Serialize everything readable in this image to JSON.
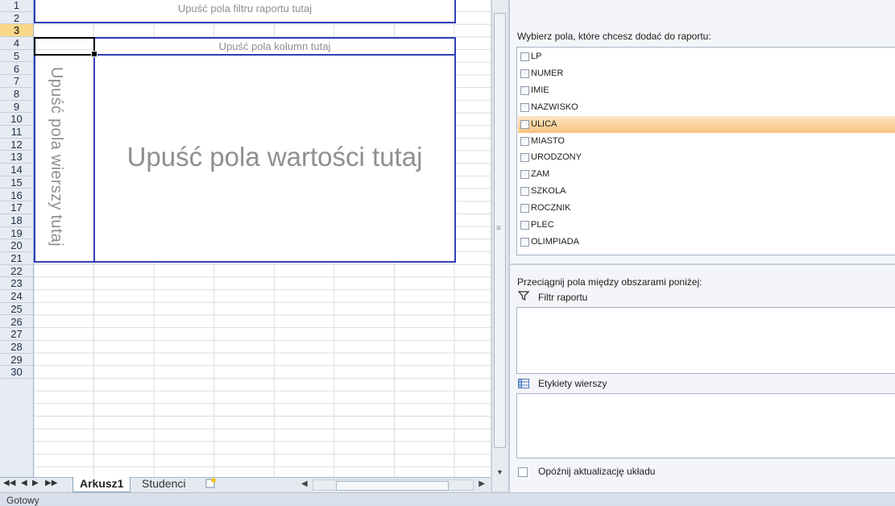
{
  "sheet": {
    "row_numbers": [
      "1",
      "2",
      "3",
      "4",
      "5",
      "6",
      "7",
      "8",
      "9",
      "10",
      "11",
      "12",
      "13",
      "14",
      "15",
      "16",
      "17",
      "18",
      "19",
      "20",
      "21",
      "22",
      "23",
      "24",
      "25",
      "26",
      "27",
      "28",
      "29",
      "30"
    ],
    "selected_row": "3",
    "filter_drop_text": "Upuść pola filtru raportu tutaj",
    "column_drop_text": "Upuść pola kolumn tutaj",
    "row_drop_text": "Upuść pola wierszy tutaj",
    "values_drop_text": "Upuść pola wartości tutaj"
  },
  "tabs": {
    "nav_first": "◀◀",
    "nav_prev": "◀",
    "nav_next": "▶",
    "nav_last": "▶▶",
    "items": [
      "Arkusz1",
      "Studenci"
    ],
    "active": "Arkusz1",
    "new_tab_icon": "insert-worksheet-icon"
  },
  "statusbar": {
    "text": "Gotowy"
  },
  "pivot_pane": {
    "choose_label": "Wybierz pola, które chcesz dodać do raportu:",
    "fields": [
      {
        "label": "LP",
        "checked": false
      },
      {
        "label": "NUMER",
        "checked": false
      },
      {
        "label": "IMIE",
        "checked": false
      },
      {
        "label": "NAZWISKO",
        "checked": false
      },
      {
        "label": "ULICA",
        "checked": false,
        "highlighted": true
      },
      {
        "label": "MIASTO",
        "checked": false
      },
      {
        "label": "URODZONY",
        "checked": false
      },
      {
        "label": "ZAM",
        "checked": false
      },
      {
        "label": "SZKOLA",
        "checked": false
      },
      {
        "label": "ROCZNIK",
        "checked": false
      },
      {
        "label": "PLEC",
        "checked": false
      },
      {
        "label": "OLIMPIADA",
        "checked": false
      }
    ],
    "drag_label": "Przeciągnij pola między obszarami poniżej:",
    "filter_label": "Filtr raportu",
    "rows_label": "Etykiety wierszy",
    "defer_label": "Opóźnij aktualizację układu",
    "defer_checked": false
  },
  "colors": {
    "pivot_border": "#2f3fb4",
    "selection_highlight": "#f9d988",
    "field_highlight": "#f8c27d"
  }
}
